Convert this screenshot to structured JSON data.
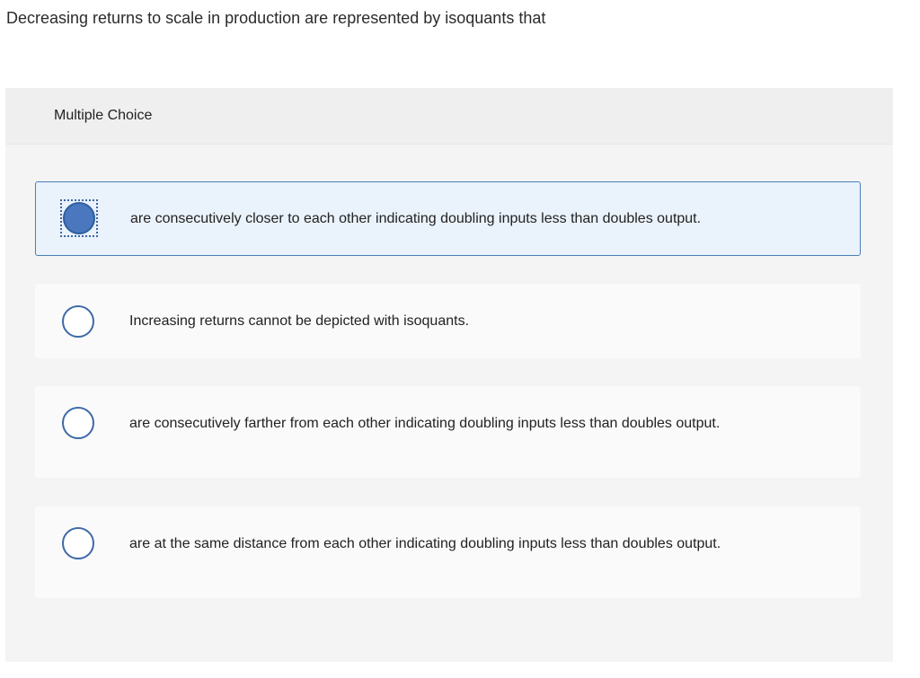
{
  "question": {
    "text": "Decreasing returns to scale in production are represented by isoquants that"
  },
  "panel": {
    "header": "Multiple Choice"
  },
  "options": [
    {
      "text": "are consecutively closer to each other indicating doubling inputs less than doubles output.",
      "selected": true
    },
    {
      "text": "Increasing returns cannot be depicted with isoquants.",
      "selected": false
    },
    {
      "text": "are consecutively farther from each other indicating doubling inputs less than doubles output.",
      "selected": false
    },
    {
      "text": "are at the same distance from each other indicating doubling inputs less than doubles output.",
      "selected": false
    }
  ],
  "colors": {
    "selected_bg": "#eaf2fb",
    "selected_border": "#4a7fb8",
    "radio_fill": "#4a77bd",
    "radio_stroke": "#3d6aa7"
  }
}
